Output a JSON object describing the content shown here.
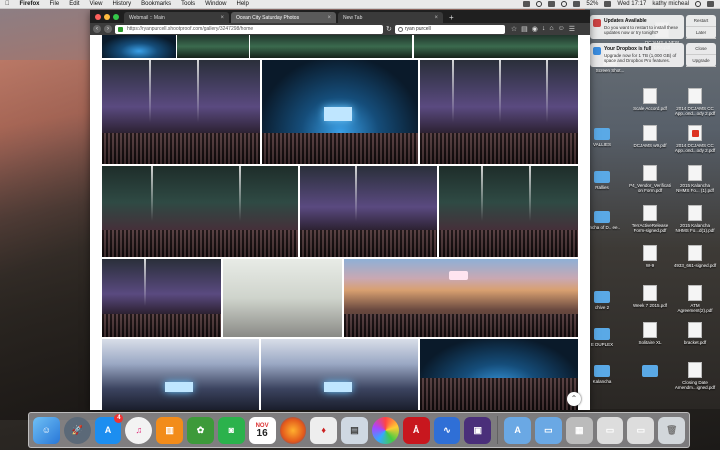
{
  "menubar": {
    "app": "Firefox",
    "items": [
      "File",
      "Edit",
      "View",
      "History",
      "Bookmarks",
      "Tools",
      "Window",
      "Help"
    ],
    "battery": "52%",
    "day_time": "Wed 17:17",
    "user": "kathy micheal"
  },
  "browser": {
    "tabs": [
      {
        "label": "Webmail :: Main"
      },
      {
        "label": "Ocean City Saturday Photos"
      },
      {
        "label": "New Tab"
      }
    ],
    "newtab_glyph": "+",
    "url": "https://ryanpurcell.shootproof.com/gallery/3247298/home",
    "search": "ryan purcell"
  },
  "notifications": {
    "updates": {
      "title": "Updates Available",
      "body": "Do you want to restart to install these updates now or try tonight?",
      "btn1": "Restart",
      "btn2": "Later"
    },
    "dropbox": {
      "title": "Your Dropbox is full",
      "body": "Upgrade now for 1 TB (1,000 GB) of space and Dropbox Pro features.",
      "btn1": "Close",
      "btn2": "Upgrade"
    }
  },
  "desktop": {
    "labels": [
      "DCJAMS A NEW ERA.pdf",
      "Screen Shot...",
      "Scale Accord.pdf",
      "2014 DCJAMS CC App..ond...ody 2.pdf",
      "VALLIES",
      "DCJAMS w9.pdf",
      "2014 DCJAMS CC App..ond...ody 2.pdf",
      "Rallies",
      "P4_Vendor_Verificati on Form.pdf",
      "2015 Kalancha NHMS Fo... (1).pdf",
      "Kancha of D.. ee..",
      "TerrActiveRelease Form-signed.pdf",
      "2015 Kalancha NHMS Fo...d(1).pdf",
      "W-9",
      "4933_661-signed.pdf",
      "chive 2",
      "Week 7 2015.pdf",
      "ATM Agreement(2).pdf",
      "E DUPLEX",
      "Solitaire XL",
      "bracket.pdf",
      "Kalancha",
      "Closing Date Amendm...igned.pdf"
    ]
  },
  "dock": {
    "app_store_badge": "4",
    "calendar_month": "NOV",
    "calendar_day": "16"
  }
}
